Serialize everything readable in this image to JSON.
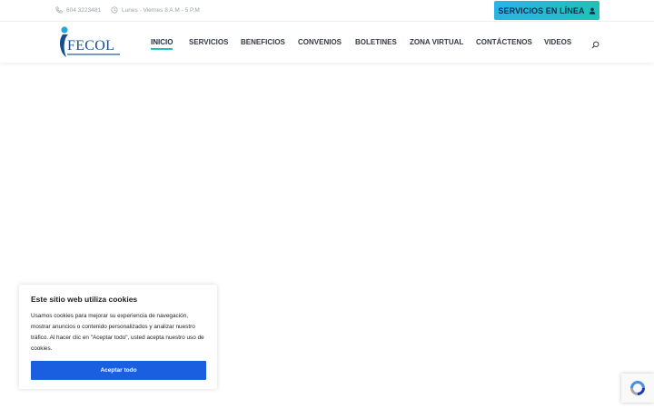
{
  "topbar": {
    "phone": "604 3223481",
    "hours": "Lunes - Viernes 8 A.M - 5 P.M",
    "online_button": "SERVICIOS EN LÍNEA"
  },
  "logo": {
    "text": "FECOL"
  },
  "nav": {
    "items": [
      "INICIO",
      "SERVICIOS",
      "BENEFICIOS",
      "CONVENIOS",
      "BOLETINES",
      "ZONA VIRTUAL",
      "CONTÁCTENOS",
      "VIDEOS"
    ],
    "active": "INICIO"
  },
  "cookie": {
    "title": "Este sitio web utiliza cookies",
    "body": "Usamos cookies para mejorar su experiencia de navegación, mostrar anuncios o contenido personalizados y analizar nuestro tráfico. Al hacer clic en \"Aceptar todo\", usted acepta nuestro uso de cookies.",
    "accept": "Aceptar todo"
  },
  "colors": {
    "accent": "#1fc3b5",
    "brand": "#1a4d8f",
    "button_blue": "#1a5fe0"
  }
}
